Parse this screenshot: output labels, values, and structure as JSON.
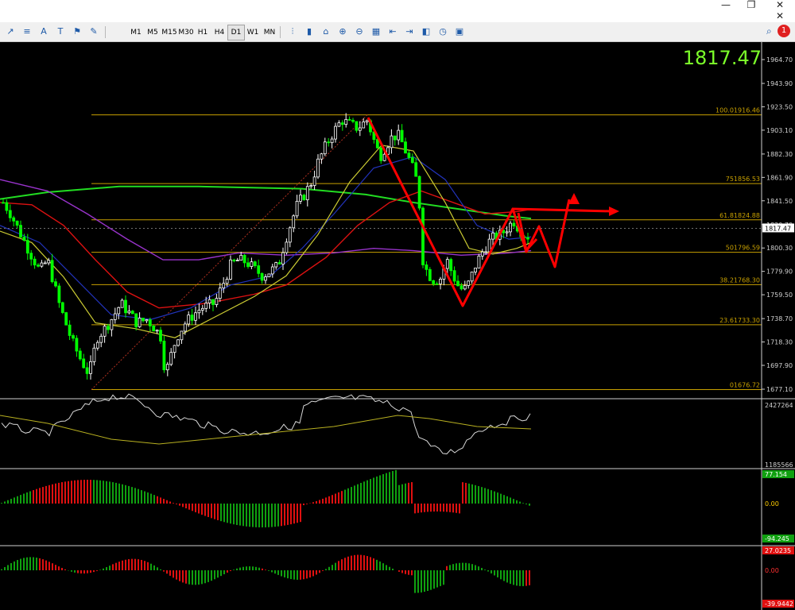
{
  "window": {
    "minimize_glyph": "—",
    "restore_glyph": "❐",
    "close_glyph": "✕",
    "inner_close_glyph": "✕",
    "notification_count": "1"
  },
  "toolbar": {
    "timeframes": [
      "M1",
      "M5",
      "M15",
      "M30",
      "H1",
      "H4",
      "D1",
      "W1",
      "MN"
    ],
    "active_timeframe": "D1",
    "left_tool_glyphs": [
      "↗",
      "≡",
      "A",
      "T",
      "⚑",
      "✎"
    ],
    "chart_tool_glyphs": [
      "⫶",
      "▮",
      "⌂",
      "⊕",
      "⊖",
      "▦",
      "⇤",
      "⇥",
      "◧",
      "◷",
      "▣"
    ]
  },
  "chart_data": {
    "type": "candlestick",
    "current_price": "1817.47",
    "price_axis_labels": [
      "1964.70",
      "1943.90",
      "1923.50",
      "1903.10",
      "1882.30",
      "1861.90",
      "1841.50",
      "1820.70",
      "1800.30",
      "1779.90",
      "1759.50",
      "1738.70",
      "1718.30",
      "1697.90",
      "1677.10"
    ],
    "current_price_tag": "1817.47",
    "fib_levels": [
      {
        "label": "100.01916.46",
        "price": 1916.46
      },
      {
        "label": "751856.53",
        "price": 1856.53
      },
      {
        "label": "61.81824.88",
        "price": 1824.88
      },
      {
        "label": "501796.59",
        "price": 1796.59
      },
      {
        "label": "38.21768.30",
        "price": 1768.3
      },
      {
        "label": "23.61733.30",
        "price": 1733.3
      },
      {
        "label": "01676.72",
        "price": 1676.72
      }
    ],
    "sub_panels": [
      {
        "name": "volume oscillator",
        "top_label": "2427264",
        "bottom_label": "1185566"
      },
      {
        "name": "histogram 1",
        "top_label": "77.154",
        "zero_label": "0.00",
        "bottom_label": "-94.245"
      },
      {
        "name": "histogram 2",
        "top_label": "27.0235",
        "zero_label": "0.00",
        "bottom_label": "-39.9442"
      }
    ],
    "colors": {
      "background": "#000000",
      "bull_candle": "#ffffff",
      "bear_candle": "#00ff00",
      "fib": "#c8a000",
      "ma_green": "#22dd22",
      "ma_purple": "#9933cc",
      "ma_red": "#dd1111",
      "ma_blue": "#2233bb",
      "ma_yellow": "#cccc33",
      "annotation": "#ff0000",
      "price_big": "#7cff2a",
      "hist_pos": "#10a010",
      "hist_neg": "#e01010"
    }
  }
}
